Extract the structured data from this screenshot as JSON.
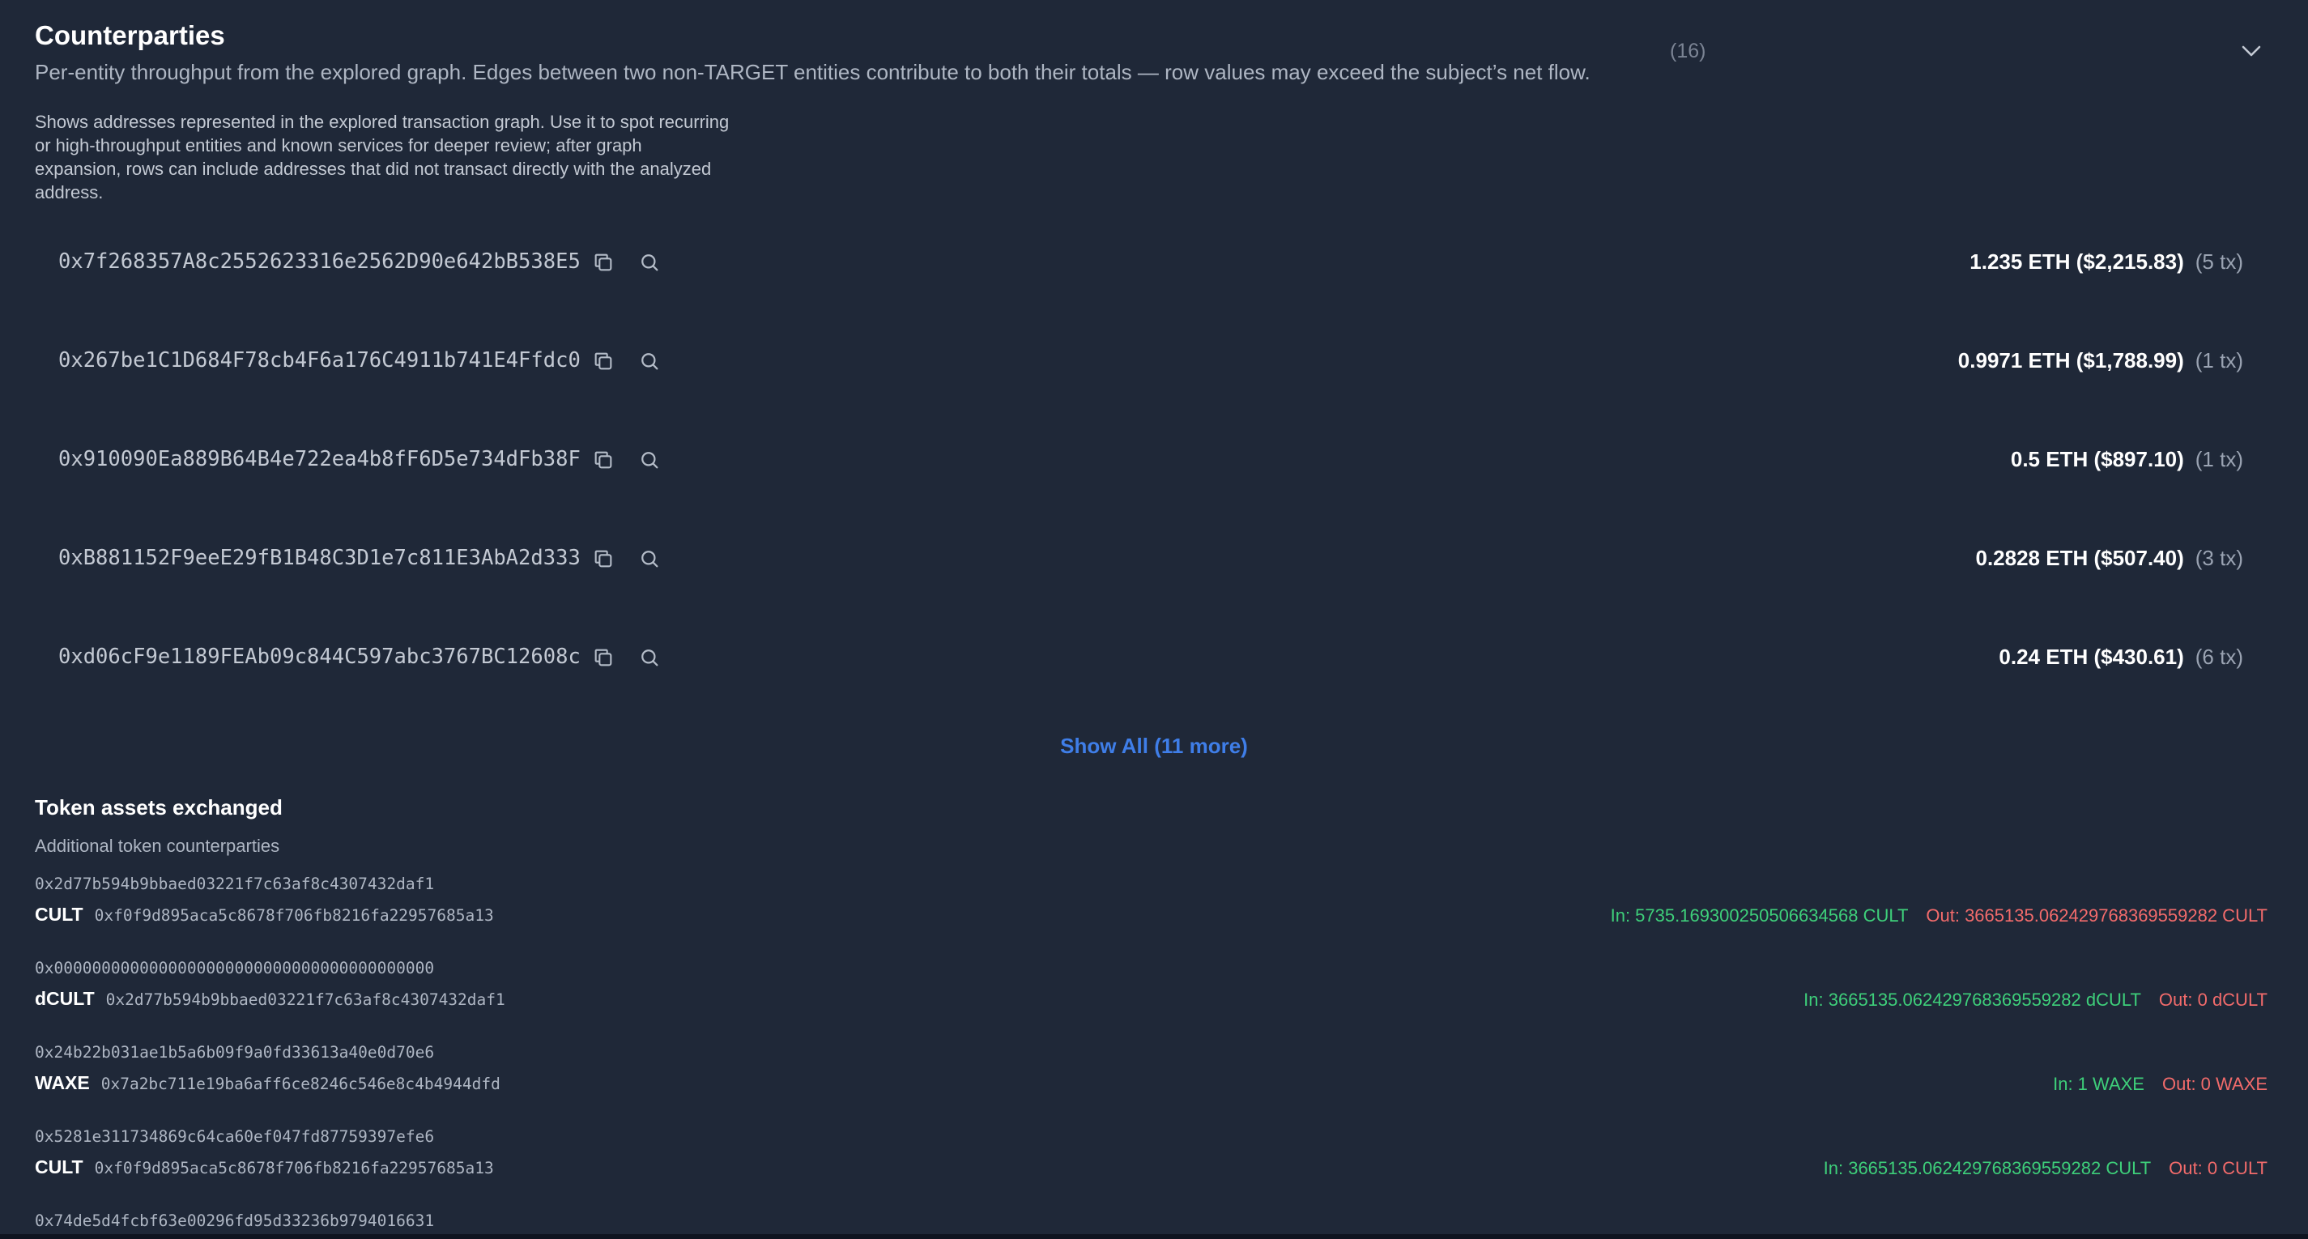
{
  "header": {
    "title": "Counterparties",
    "subtitle": "Per-entity throughput from the explored graph. Edges between two non-TARGET entities contribute to both their totals — row values may exceed the subject’s net flow.",
    "count": "(16)",
    "description": "Shows addresses represented in the explored transaction graph. Use it to spot recurring or high-throughput entities and known services for deeper review; after graph expansion, rows can include addresses that did not transact directly with the analyzed address."
  },
  "counterparties": [
    {
      "address": "0x7f268357A8c2552623316e2562D90e642bB538E5",
      "amount": "1.235 ETH ($2,215.83)",
      "tx": "(5 tx)"
    },
    {
      "address": "0x267be1C1D684F78cb4F6a176C4911b741E4Ffdc0",
      "amount": "0.9971 ETH ($1,788.99)",
      "tx": "(1 tx)"
    },
    {
      "address": "0x910090Ea889B64B4e722ea4b8fF6D5e734dFb38F",
      "amount": "0.5 ETH ($897.10)",
      "tx": "(1 tx)"
    },
    {
      "address": "0xB881152F9eeE29fB1B48C3D1e7c811E3AbA2d333",
      "amount": "0.2828 ETH ($507.40)",
      "tx": "(3 tx)"
    },
    {
      "address": "0xd06cF9e1189FEAb09c844C597abc3767BC12608c",
      "amount": "0.24 ETH ($430.61)",
      "tx": "(6 tx)"
    }
  ],
  "show_all_label": "Show All (11 more)",
  "tokens": {
    "title": "Token assets exchanged",
    "subtitle": "Additional token counterparties",
    "rows": [
      {
        "from": "0x2d77b594b9bbaed03221f7c63af8c4307432daf1",
        "symbol": "CULT",
        "contract": "0xf0f9d895aca5c8678f706fb8216fa22957685a13",
        "in": "In: 5735.169300250506634568 CULT",
        "out": "Out: 3665135.062429768369559282 CULT"
      },
      {
        "from": "0x0000000000000000000000000000000000000000",
        "symbol": "dCULT",
        "contract": "0x2d77b594b9bbaed03221f7c63af8c4307432daf1",
        "in": "In: 3665135.062429768369559282 dCULT",
        "out": "Out: 0 dCULT"
      },
      {
        "from": "0x24b22b031ae1b5a6b09f9a0fd33613a40e0d70e6",
        "symbol": "WAXE",
        "contract": "0x7a2bc711e19ba6aff6ce8246c546e8c4b4944dfd",
        "in": "In: 1 WAXE",
        "out": "Out: 0 WAXE"
      },
      {
        "from": "0x5281e311734869c64ca60ef047fd87759397efe6",
        "symbol": "CULT",
        "contract": "0xf0f9d895aca5c8678f706fb8216fa22957685a13",
        "in": "In: 3665135.062429768369559282 CULT",
        "out": "Out: 0 CULT"
      },
      {
        "from": "0x74de5d4fcbf63e00296fd95d33236b9794016631",
        "symbol": "",
        "contract": "",
        "in": "",
        "out": ""
      }
    ]
  },
  "icons": {
    "copy": "copy-icon",
    "search": "search-icon",
    "collapse": "chevron-down-icon"
  },
  "colors": {
    "background": "#1f2838",
    "accent": "#3f7ee8",
    "in": "#3ecf7a",
    "out": "#f26b6b"
  }
}
